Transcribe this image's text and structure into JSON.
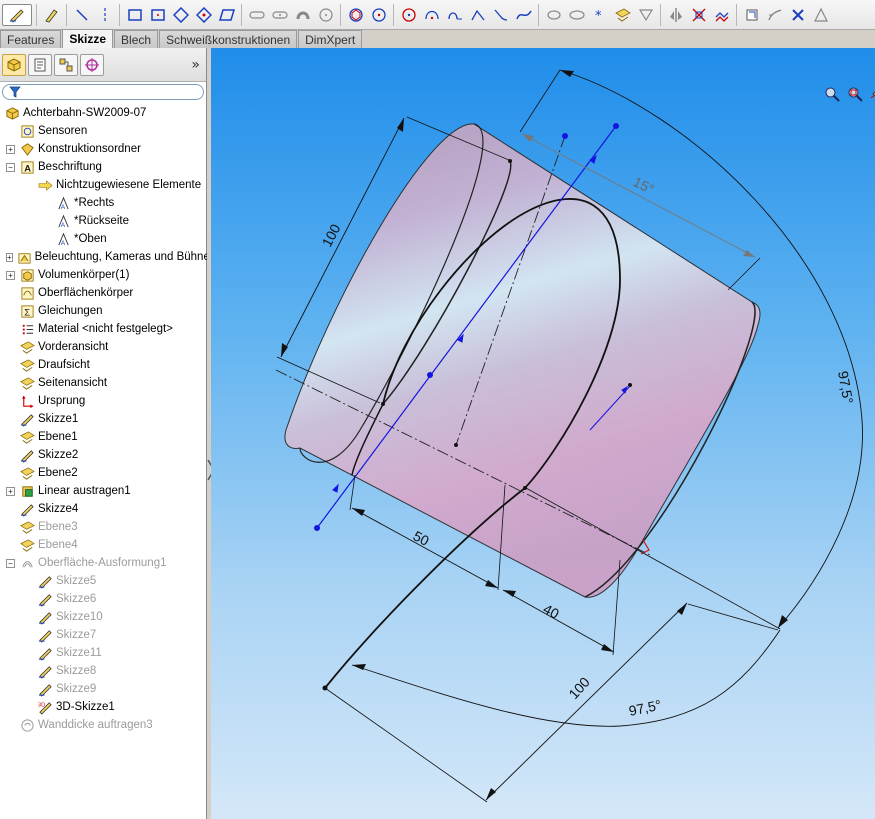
{
  "toolbar": {
    "icons": [
      "sketch-icon",
      "smart-dimension-icon",
      "line-icon",
      "centerline-icon",
      "rectangle-icon",
      "center-rectangle-icon",
      "3-point-corner-rectangle-icon",
      "3-point-center-rectangle-icon",
      "parallelogram-icon",
      "slot-icon",
      "centerpoint-slot-icon",
      "3-point-arc-slot-icon",
      "centerpoint-arc-slot-icon",
      "polygon-icon",
      "circle-icon",
      "perimeter-circle-icon",
      "centerpoint-arc-icon",
      "tangent-arc-icon",
      "3-point-arc-icon",
      "fillet-icon",
      "spline-icon",
      "ellipse-icon",
      "partial-ellipse-icon",
      "point-icon",
      "plane-icon",
      "text-icon",
      "mirror-icon",
      "trim-icon",
      "offset-icon",
      "convert-entities-icon",
      "pattern-icon",
      "move-icon",
      "display-relations-icon"
    ]
  },
  "tabs": [
    {
      "label": "Features",
      "active": false
    },
    {
      "label": "Skizze",
      "active": true
    },
    {
      "label": "Blech",
      "active": false
    },
    {
      "label": "Schweißkonstruktionen",
      "active": false
    },
    {
      "label": "DimXpert",
      "active": false
    }
  ],
  "feature_manager": {
    "tabs": [
      "featuremanager-icon",
      "propertymanager-icon",
      "configurationmanager-icon",
      "dimxpertmanager-icon"
    ],
    "expand_label": "»",
    "filter_icon": "filter-icon",
    "tree": [
      {
        "label": "Achterbahn-SW2009-07",
        "icon": "part-icon",
        "indent": 0,
        "pm": "none",
        "gray": false
      },
      {
        "label": "Sensoren",
        "icon": "sensor-icon",
        "indent": 1,
        "pm": "none",
        "gray": false
      },
      {
        "label": "Konstruktionsordner",
        "icon": "design-binder-icon",
        "indent": 1,
        "pm": "+",
        "gray": false
      },
      {
        "label": "Beschriftung",
        "icon": "annotations-icon",
        "indent": 1,
        "pm": "-",
        "gray": false
      },
      {
        "label": "Nichtzugewiesene Elemente",
        "icon": "unassigned-items-icon",
        "indent": 2,
        "pm": "none",
        "gray": false
      },
      {
        "label": "*Rechts",
        "icon": "annotation-view-icon",
        "indent": 3,
        "pm": "none",
        "gray": false
      },
      {
        "label": "*Rückseite",
        "icon": "annotation-view-icon",
        "indent": 3,
        "pm": "none",
        "gray": false
      },
      {
        "label": "*Oben",
        "icon": "annotation-view-icon",
        "indent": 3,
        "pm": "none",
        "gray": false
      },
      {
        "label": "Beleuchtung, Kameras und Bühne",
        "icon": "lights-icon",
        "indent": 1,
        "pm": "+",
        "gray": false
      },
      {
        "label": "Volumenkörper(1)",
        "icon": "solid-bodies-icon",
        "indent": 1,
        "pm": "+",
        "gray": false
      },
      {
        "label": "Oberflächenkörper",
        "icon": "surface-bodies-icon",
        "indent": 1,
        "pm": "none",
        "gray": false
      },
      {
        "label": "Gleichungen",
        "icon": "equations-icon",
        "indent": 1,
        "pm": "none",
        "gray": false
      },
      {
        "label": "Material <nicht festgelegt>",
        "icon": "material-icon",
        "indent": 1,
        "pm": "none",
        "gray": false
      },
      {
        "label": "Vorderansicht",
        "icon": "plane-icon",
        "indent": 1,
        "pm": "none",
        "gray": false
      },
      {
        "label": "Draufsicht",
        "icon": "plane-icon",
        "indent": 1,
        "pm": "none",
        "gray": false
      },
      {
        "label": "Seitenansicht",
        "icon": "plane-icon",
        "indent": 1,
        "pm": "none",
        "gray": false
      },
      {
        "label": "Ursprung",
        "icon": "origin-icon",
        "indent": 1,
        "pm": "none",
        "gray": false
      },
      {
        "label": "Skizze1",
        "icon": "sketch-icon",
        "indent": 1,
        "pm": "none",
        "gray": false
      },
      {
        "label": "Ebene1",
        "icon": "plane-icon",
        "indent": 1,
        "pm": "none",
        "gray": false
      },
      {
        "label": "Skizze2",
        "icon": "sketch-icon",
        "indent": 1,
        "pm": "none",
        "gray": false
      },
      {
        "label": "Ebene2",
        "icon": "plane-icon",
        "indent": 1,
        "pm": "none",
        "gray": false
      },
      {
        "label": "Linear austragen1",
        "icon": "extrude-icon",
        "indent": 1,
        "pm": "+",
        "gray": false
      },
      {
        "label": "Skizze4",
        "icon": "sketch-icon",
        "indent": 1,
        "pm": "none",
        "gray": false
      },
      {
        "label": "Ebene3",
        "icon": "plane-icon",
        "indent": 1,
        "pm": "none",
        "gray": true
      },
      {
        "label": "Ebene4",
        "icon": "plane-icon",
        "indent": 1,
        "pm": "none",
        "gray": true
      },
      {
        "label": "Oberfläche-Ausformung1",
        "icon": "surface-loft-icon",
        "indent": 1,
        "pm": "-",
        "gray": true
      },
      {
        "label": "Skizze5",
        "icon": "sketch-icon",
        "indent": 2,
        "pm": "none",
        "gray": true
      },
      {
        "label": "Skizze6",
        "icon": "sketch-icon",
        "indent": 2,
        "pm": "none",
        "gray": true
      },
      {
        "label": "Skizze10",
        "icon": "sketch-icon",
        "indent": 2,
        "pm": "none",
        "gray": true
      },
      {
        "label": "Skizze7",
        "icon": "sketch-icon",
        "indent": 2,
        "pm": "none",
        "gray": true
      },
      {
        "label": "Skizze11",
        "icon": "sketch-icon",
        "indent": 2,
        "pm": "none",
        "gray": true
      },
      {
        "label": "Skizze8",
        "icon": "sketch-icon",
        "indent": 2,
        "pm": "none",
        "gray": true
      },
      {
        "label": "Skizze9",
        "icon": "sketch-icon",
        "indent": 2,
        "pm": "none",
        "gray": true
      },
      {
        "label": "3D-Skizze1",
        "icon": "3d-sketch-icon",
        "indent": 2,
        "pm": "none",
        "gray": false
      },
      {
        "label": "Wanddicke auftragen3",
        "icon": "thicken-icon",
        "indent": 1,
        "pm": "none",
        "gray": true
      }
    ]
  },
  "heads_up": {
    "icons": [
      "zoom-to-fit-icon",
      "zoom-to-area-icon",
      "previous-view-icon",
      "section-view-icon",
      "view-orientation-icon",
      "display-style-icon",
      "hide-show-items-icon",
      "edit-appearance-icon",
      "apply-scene-icon",
      "view-settings-icon"
    ]
  },
  "dimensions": {
    "d100_left": "100",
    "d15": "15°",
    "d97_5_right": "97,5°",
    "d50": "50",
    "d40": "40",
    "d100_bottom": "100",
    "d97_5_bottom": "97,5°"
  },
  "colors": {
    "accent_tab": "#f4f4f4",
    "sketch_blue": "#1515e0",
    "body_pink": "#d6a8cf",
    "dimension_line": "#000000"
  }
}
